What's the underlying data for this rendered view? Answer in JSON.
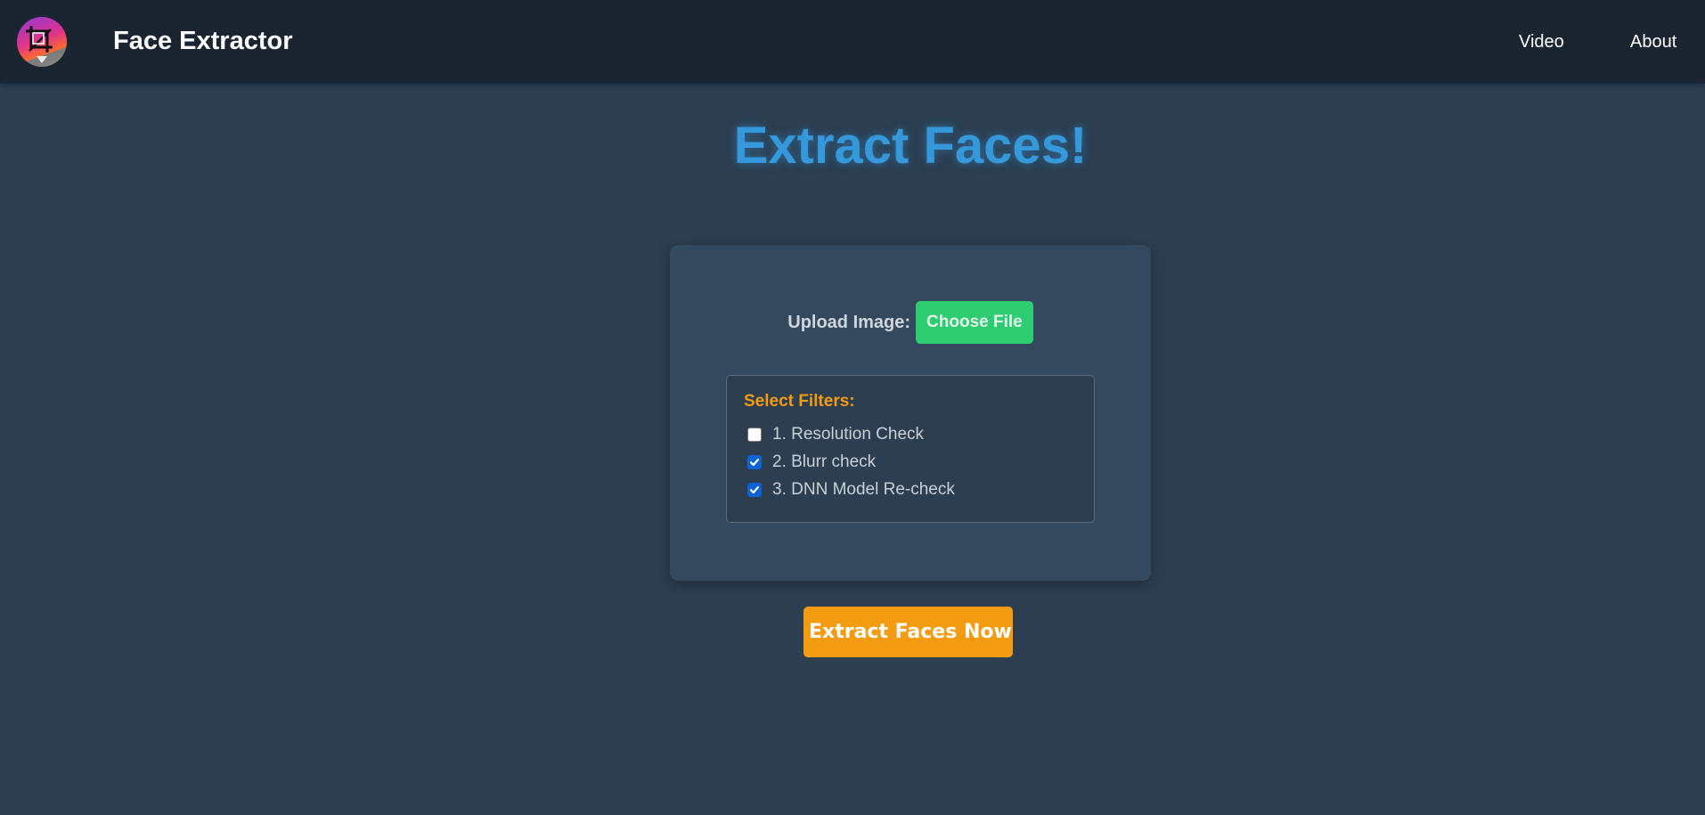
{
  "navbar": {
    "logo_icon": "face-crop-logo-icon",
    "brand": "Face Extractor",
    "links": [
      {
        "label": "Video"
      },
      {
        "label": "About"
      }
    ]
  },
  "main": {
    "headline": "Extract Faces!",
    "upload": {
      "label": "Upload Image:",
      "button_label": "Choose File"
    },
    "filters": {
      "title": "Select Filters:",
      "items": [
        {
          "label": "1. Resolution Check",
          "checked": false
        },
        {
          "label": "2. Blurr check",
          "checked": true
        },
        {
          "label": "3. DNN Model Re-check",
          "checked": true
        }
      ]
    },
    "submit_label": "Extract Faces Now"
  },
  "colors": {
    "background": "#2c3e50",
    "navbar": "#1b2431",
    "card": "#34495e",
    "headline": "#3498db",
    "upload_button": "#2ecc71",
    "accent": "#f39c12",
    "checkbox_checked": "#0b63d6"
  }
}
